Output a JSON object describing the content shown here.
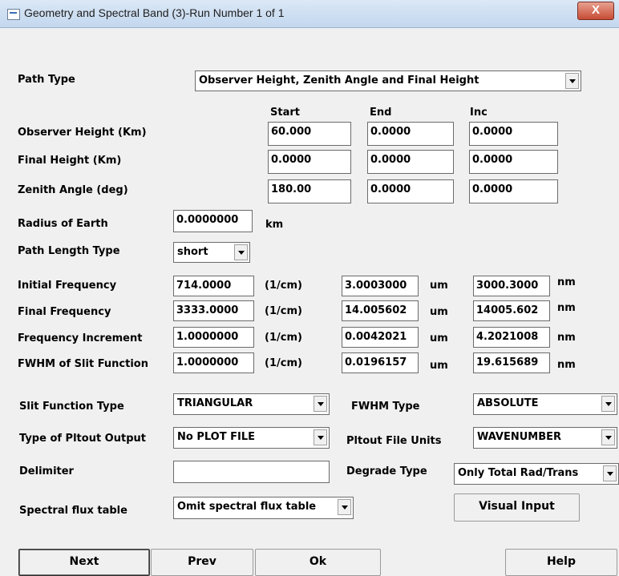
{
  "window": {
    "title": "Geometry and Spectral Band (3)-Run Number  1 of  1",
    "close": "X"
  },
  "path_type": {
    "label": "Path Type",
    "value": "Observer Height, Zenith Angle and Final Height"
  },
  "columns": {
    "start": "Start",
    "end": "End",
    "inc": "Inc"
  },
  "heights": [
    {
      "label": "Observer Height (Km)",
      "start": "60.000",
      "end": "0.0000",
      "inc": "0.0000"
    },
    {
      "label": "Final Height (Km)",
      "start": "0.0000",
      "end": "0.0000",
      "inc": "0.0000"
    },
    {
      "label": "Zenith Angle (deg)",
      "start": "180.00",
      "end": "0.0000",
      "inc": "0.0000"
    }
  ],
  "earth": {
    "label": "Radius of Earth",
    "value": "0.0000000",
    "unit": "km"
  },
  "path_length": {
    "label": "Path Length Type",
    "value": "short"
  },
  "frequencies": [
    {
      "label": "Initial Frequency",
      "cm": "714.0000",
      "cm_unit": "(1/cm)",
      "um": "3.0003000",
      "um_unit": "um",
      "nm": "3000.3000",
      "nm_unit": "nm"
    },
    {
      "label": "Final Frequency",
      "cm": "3333.0000",
      "cm_unit": "(1/cm)",
      "um": "14.005602",
      "um_unit": "um",
      "nm": "14005.602",
      "nm_unit": "nm"
    },
    {
      "label": "Frequency Increment",
      "cm": "1.0000000",
      "cm_unit": "(1/cm)",
      "um": "0.0042021",
      "um_unit": "um",
      "nm": "4.2021008",
      "nm_unit": "nm"
    },
    {
      "label": "FWHM of Slit Function",
      "cm": "1.0000000",
      "cm_unit": "(1/cm)",
      "um": "0.0196157",
      "um_unit": "um",
      "nm": "19.615689",
      "nm_unit": "nm"
    }
  ],
  "slit": {
    "label": "Slit Function Type",
    "value": "TRIANGULAR"
  },
  "fwhm_type": {
    "label": "FWHM Type",
    "value": "ABSOLUTE"
  },
  "pltout": {
    "label": "Type of Pltout Output",
    "value": "No PLOT FILE"
  },
  "pltout_units": {
    "label": "Pltout File Units",
    "value": "WAVENUMBER"
  },
  "delimiter": {
    "label": "Delimiter",
    "value": ""
  },
  "degrade": {
    "label": "Degrade Type",
    "value": "Only Total Rad/Trans"
  },
  "spectral": {
    "label": "Spectral flux table",
    "value": "Omit spectral flux table"
  },
  "buttons": {
    "visual_input": "Visual Input",
    "next": "Next",
    "prev": "Prev",
    "ok": "Ok",
    "help": "Help"
  }
}
